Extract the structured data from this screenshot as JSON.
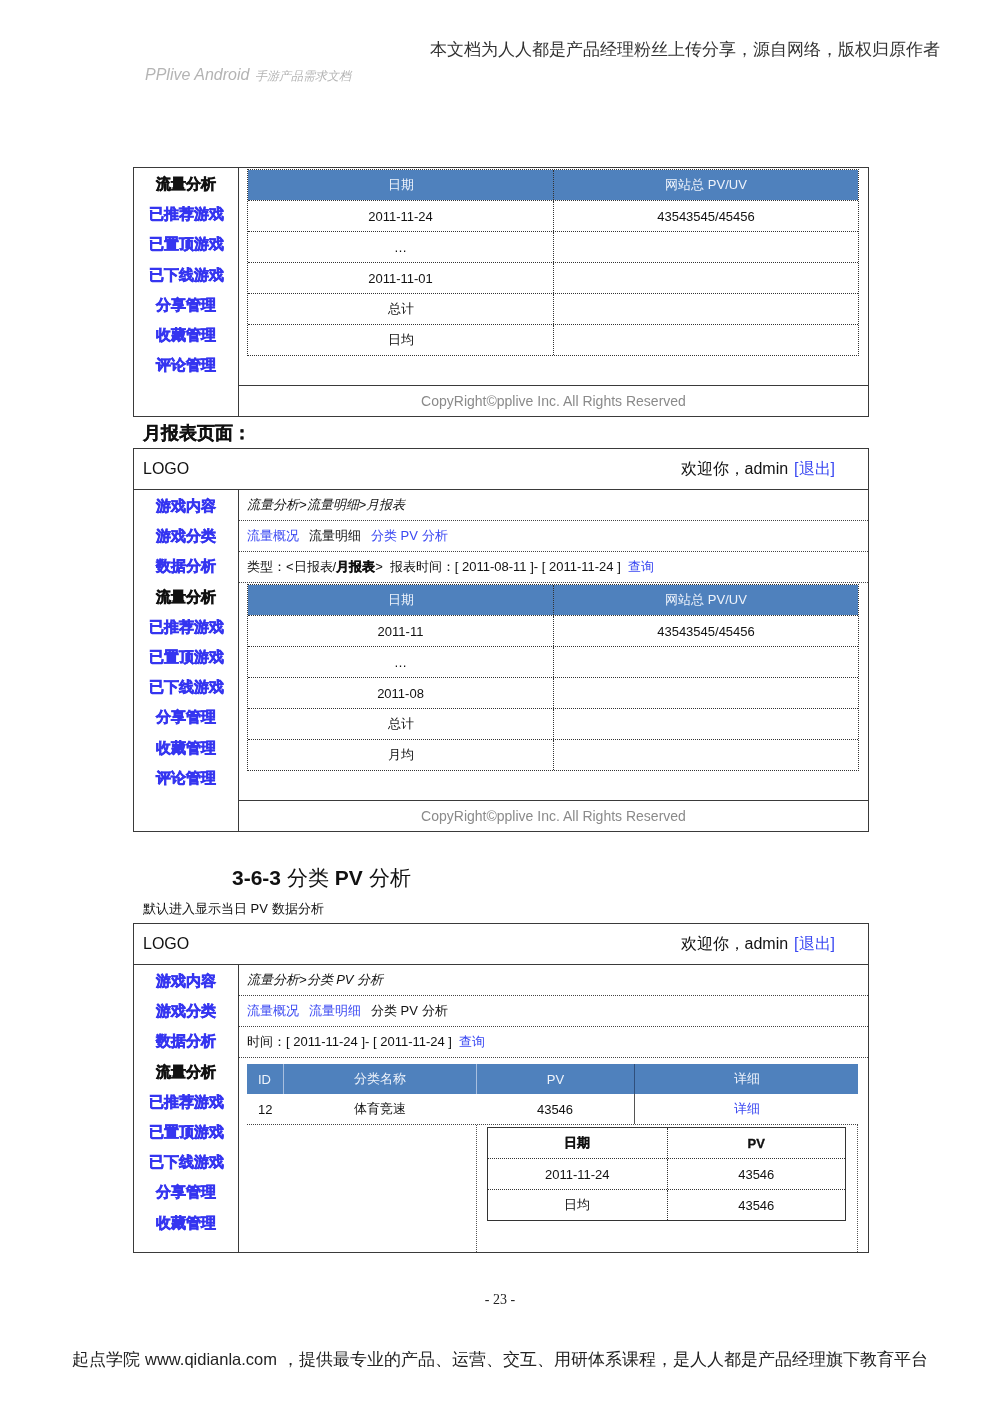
{
  "doc_header": {
    "notice": "本文档为人人都是产品经理粉丝上传分享，源自网络，版权归原作者",
    "product": "PPlive Android",
    "doc_title": "手游产品需求文档"
  },
  "sections": [
    {
      "mockup": {
        "sidebar": [
          {
            "label": "流量分析",
            "selected": true
          },
          {
            "label": "已推荐游戏",
            "selected": false
          },
          {
            "label": "已置顶游戏",
            "selected": false
          },
          {
            "label": "已下线游戏",
            "selected": false
          },
          {
            "label": "分享管理",
            "selected": false
          },
          {
            "label": "收藏管理",
            "selected": false
          },
          {
            "label": "评论管理",
            "selected": false
          }
        ],
        "table": {
          "kind": "report",
          "columns": [
            "日期",
            "网站总 PV/UV"
          ],
          "rows": [
            {
              "date": "2011-11-24",
              "pv_uv": "43543545/45456"
            },
            {
              "date": "…"
            },
            {
              "date": "2011-11-01"
            },
            {
              "date": "总计"
            },
            {
              "date": "日均"
            }
          ]
        },
        "copyright": "CopyRight©pplive Inc. All Rights Reserved"
      }
    },
    {
      "heading": {
        "kind": "label",
        "text": "月报表页面："
      },
      "mockup": {
        "header": {
          "logo": "LOGO",
          "greeting": "欢迎你，admin",
          "logout": "[退出]"
        },
        "sidebar": [
          {
            "label": "游戏内容",
            "selected": false
          },
          {
            "label": "游戏分类",
            "selected": false
          },
          {
            "label": "数据分析",
            "selected": false
          },
          {
            "label": "流量分析",
            "selected": true
          },
          {
            "label": "已推荐游戏",
            "selected": false
          },
          {
            "label": "已置顶游戏",
            "selected": false
          },
          {
            "label": "已下线游戏",
            "selected": false
          },
          {
            "label": "分享管理",
            "selected": false
          },
          {
            "label": "收藏管理",
            "selected": false
          },
          {
            "label": "评论管理",
            "selected": false
          }
        ],
        "breadcrumb": "流量分析>流量明细>月报表",
        "tabs": [
          {
            "label": "流量概况",
            "selected": false
          },
          {
            "label": "流量明细",
            "selected": true
          },
          {
            "label": "分类 PV 分析",
            "selected": false
          }
        ],
        "filter": {
          "report_type": {
            "label": "类型：",
            "open": "<",
            "options": [
              {
                "label": "日报表",
                "selected": false
              },
              {
                "label": "月报表",
                "selected": true
              }
            ],
            "separator": "/",
            "close": ">"
          },
          "period": "报表时间：[ 2011-08-11 ]- [ 2011-11-24 ]",
          "query_link": "查询"
        },
        "table": {
          "kind": "report",
          "columns": [
            "日期",
            "网站总 PV/UV"
          ],
          "rows": [
            {
              "date": "2011-11",
              "pv_uv": "43543545/45456"
            },
            {
              "date": "…"
            },
            {
              "date": "2011-08"
            },
            {
              "date": "总计"
            },
            {
              "date": "月均"
            }
          ]
        },
        "copyright": "CopyRight©pplive Inc. All Rights Reserved"
      }
    },
    {
      "heading": {
        "kind": "numbered",
        "text": "**3-6-3** 分类 **PV** 分析"
      },
      "description": "默认进入显示当日 PV 数据分析",
      "mockup": {
        "header": {
          "logo": "LOGO",
          "greeting": "欢迎你，admin",
          "logout": "[退出]"
        },
        "sidebar": [
          {
            "label": "游戏内容",
            "selected": false
          },
          {
            "label": "游戏分类",
            "selected": false
          },
          {
            "label": "数据分析",
            "selected": false
          },
          {
            "label": "流量分析",
            "selected": true
          },
          {
            "label": "已推荐游戏",
            "selected": false
          },
          {
            "label": "已置顶游戏",
            "selected": false
          },
          {
            "label": "已下线游戏",
            "selected": false
          },
          {
            "label": "分享管理",
            "selected": false
          },
          {
            "label": "收藏管理",
            "selected": false
          }
        ],
        "breadcrumb": "流量分析>分类 PV 分析",
        "tabs": [
          {
            "label": "流量概况",
            "selected": false
          },
          {
            "label": "流量明细",
            "selected": false
          },
          {
            "label": "分类 PV 分析",
            "selected": true
          }
        ],
        "filter": {
          "period": "时间：[ 2011-11-24 ]- [ 2011-11-24 ]",
          "query_link": "查询"
        },
        "table": {
          "kind": "category",
          "columns": [
            "ID",
            "分类名称",
            "PV",
            "详细"
          ],
          "rows": [
            {
              "id": "12",
              "name": "体育竞速",
              "pv": "43546",
              "detail_link": "详细"
            }
          ],
          "detail_popup": {
            "columns": [
              "日期",
              "PV"
            ],
            "rows": [
              {
                "date": "2011-11-24",
                "pv": "43546"
              },
              {
                "date": "日均",
                "pv": "43546"
              }
            ]
          }
        }
      }
    }
  ],
  "page_number": "- 23 -",
  "footer": "起点学院 www.qidianla.com ，提供最专业的产品、运营、交互、用研体系课程，是人人都是产品经理旗下教育平台"
}
